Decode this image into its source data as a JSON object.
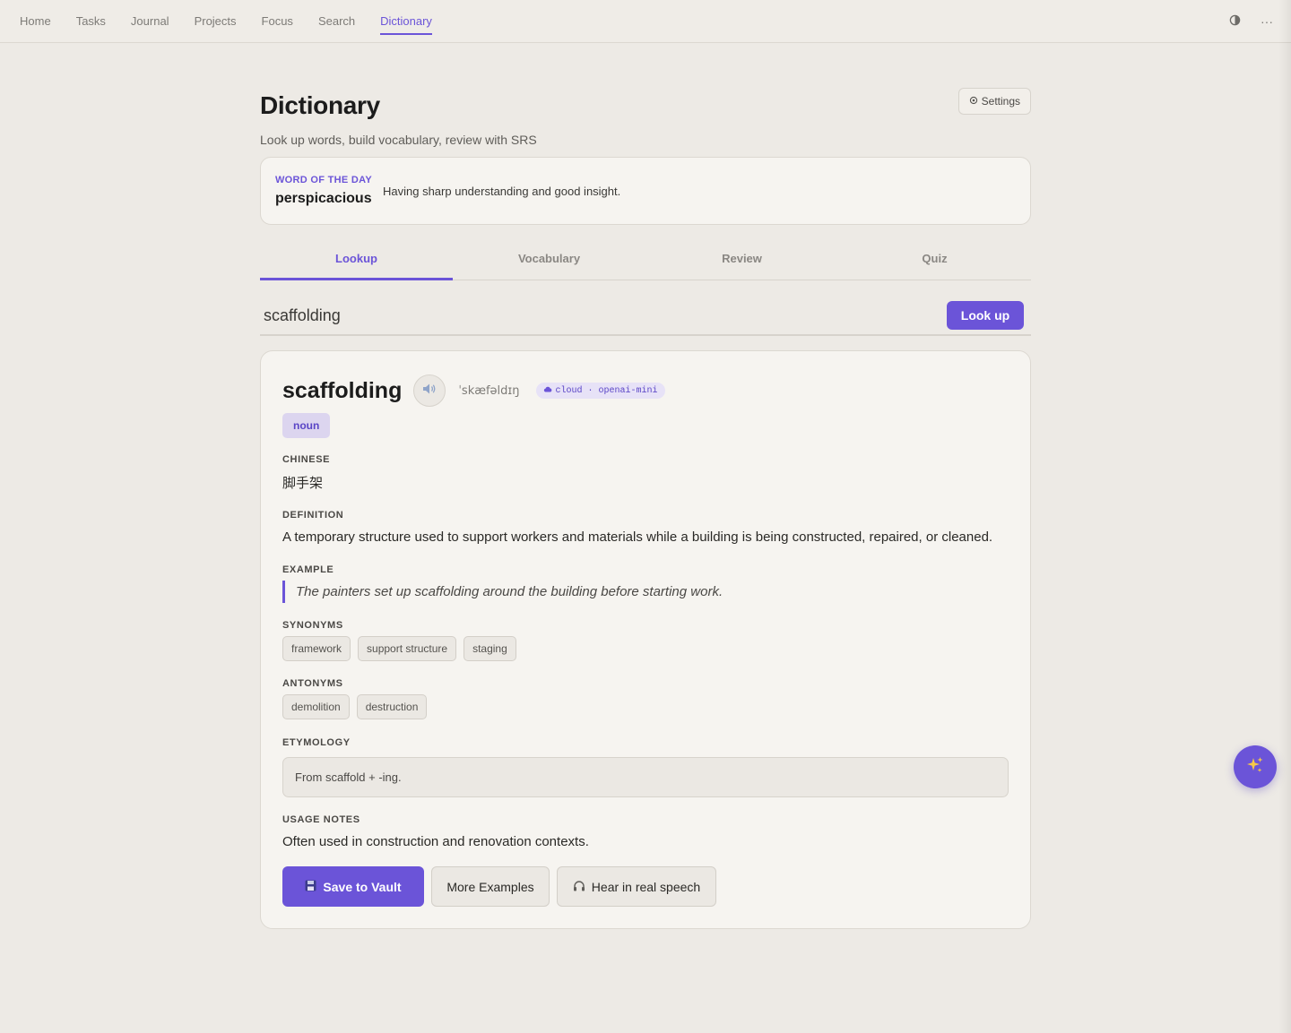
{
  "nav": {
    "items": [
      {
        "label": "Home"
      },
      {
        "label": "Tasks"
      },
      {
        "label": "Journal"
      },
      {
        "label": "Projects"
      },
      {
        "label": "Focus"
      },
      {
        "label": "Search"
      },
      {
        "label": "Dictionary"
      }
    ],
    "active": "Dictionary",
    "right_icons": [
      "theme-toggle-icon",
      "more-icon"
    ],
    "more_glyph": "···"
  },
  "page": {
    "title": "Dictionary",
    "subtitle": "Look up words, build vocabulary, review with SRS",
    "settings_label": "Settings"
  },
  "word_of_the_day": {
    "label": "WORD OF THE DAY",
    "word": "perspicacious",
    "definition": "Having sharp understanding and good insight."
  },
  "tabs": [
    {
      "label": "Lookup"
    },
    {
      "label": "Vocabulary"
    },
    {
      "label": "Review"
    },
    {
      "label": "Quiz"
    }
  ],
  "active_tab": "Lookup",
  "search": {
    "value": "scaffolding",
    "button_label": "Look up"
  },
  "entry": {
    "word": "scaffolding",
    "ipa": "ˈskæfəldɪŋ",
    "source": "cloud · openai-mini",
    "part_of_speech": "noun",
    "chinese_label": "CHINESE",
    "chinese": "脚手架",
    "definition_label": "DEFINITION",
    "definition": "A temporary structure used to support workers and materials while a building is being constructed, repaired, or cleaned.",
    "example_label": "EXAMPLE",
    "example": "The painters set up scaffolding around the building before starting work.",
    "synonyms_label": "SYNONYMS",
    "synonyms": [
      "framework",
      "support structure",
      "staging"
    ],
    "antonyms_label": "ANTONYMS",
    "antonyms": [
      "demolition",
      "destruction"
    ],
    "etymology_label": "ETYMOLOGY",
    "etymology": "From scaffold + -ing.",
    "usage_label": "USAGE NOTES",
    "usage": "Often used in construction and renovation contexts."
  },
  "actions": {
    "save": "Save to Vault",
    "more_examples": "More Examples",
    "hear": "Hear in real speech"
  },
  "colors": {
    "accent": "#6b54d8",
    "background": "#edeae5",
    "card": "#f6f4f0"
  }
}
